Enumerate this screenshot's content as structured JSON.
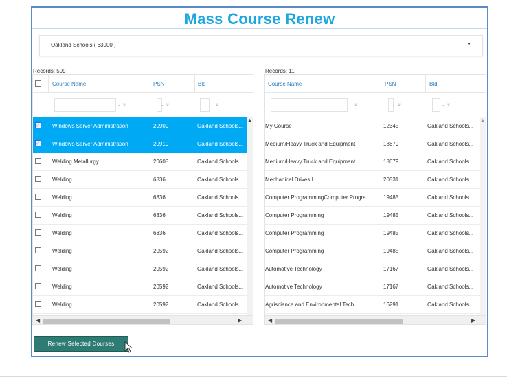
{
  "page": {
    "title": "Mass Course Renew"
  },
  "school_select": {
    "value": "Oakland Schools ( 63000 )"
  },
  "left_grid": {
    "records_label": "Records: 509",
    "columns": [
      "Course Name",
      "PSN",
      "Bld"
    ],
    "rows": [
      {
        "checked": true,
        "course": "Windows Server Administration",
        "psn": "20909",
        "bld": "Oakland Schools...",
        "selected": true
      },
      {
        "checked": true,
        "course": "Windows Server Administration",
        "psn": "20910",
        "bld": "Oakland Schools...",
        "selected": true
      },
      {
        "checked": false,
        "course": "Welding Metallurgy",
        "psn": "20605",
        "bld": "Oakland Schools...",
        "selected": false
      },
      {
        "checked": false,
        "course": "Welding",
        "psn": "6836",
        "bld": "Oakland Schools...",
        "selected": false
      },
      {
        "checked": false,
        "course": "Welding",
        "psn": "6836",
        "bld": "Oakland Schools...",
        "selected": false
      },
      {
        "checked": false,
        "course": "Welding",
        "psn": "6836",
        "bld": "Oakland Schools...",
        "selected": false
      },
      {
        "checked": false,
        "course": "Welding",
        "psn": "6836",
        "bld": "Oakland Schools...",
        "selected": false
      },
      {
        "checked": false,
        "course": "Welding",
        "psn": "20592",
        "bld": "Oakland Schools...",
        "selected": false
      },
      {
        "checked": false,
        "course": "Welding",
        "psn": "20592",
        "bld": "Oakland Schools...",
        "selected": false
      },
      {
        "checked": false,
        "course": "Welding",
        "psn": "20592",
        "bld": "Oakland Schools...",
        "selected": false
      },
      {
        "checked": false,
        "course": "Welding",
        "psn": "20592",
        "bld": "Oakland Schools...",
        "selected": false
      }
    ]
  },
  "right_grid": {
    "records_label": "Records: 11",
    "columns": [
      "Course Name",
      "PSN",
      "Bld"
    ],
    "rows": [
      {
        "course": "My Course",
        "psn": "12345",
        "bld": "Oakland Schools..."
      },
      {
        "course": "Medium/Heavy Truck and Equipment",
        "psn": "18679",
        "bld": "Oakland Schools..."
      },
      {
        "course": "Medium/Heavy Truck and Equipment",
        "psn": "18679",
        "bld": "Oakland Schools..."
      },
      {
        "course": "Mechanical Drives I",
        "psn": "20531",
        "bld": "Oakland Schools..."
      },
      {
        "course": "Computer ProgrammingComputer Progra...",
        "psn": "19485",
        "bld": "Oakland Schools..."
      },
      {
        "course": "Computer Programming",
        "psn": "19485",
        "bld": "Oakland Schools..."
      },
      {
        "course": "Computer Programming",
        "psn": "19485",
        "bld": "Oakland Schools..."
      },
      {
        "course": "Computer Programming",
        "psn": "19485",
        "bld": "Oakland Schools..."
      },
      {
        "course": "Automotive Technology",
        "psn": "17167",
        "bld": "Oakland Schools..."
      },
      {
        "course": "Automotive Technology",
        "psn": "17167",
        "bld": "Oakland Schools..."
      },
      {
        "course": "Agriscience and Environmental Tech",
        "psn": "16291",
        "bld": "Oakland Schools..."
      }
    ]
  },
  "actions": {
    "renew_label": "Renew Selected Courses"
  },
  "icons": {
    "checkbox_checked": "check-icon",
    "filter": "filter-icon",
    "dropdown": "caret-down-icon"
  },
  "colors": {
    "title": "#1fa8e0",
    "selected_row": "#00a9f4",
    "button": "#2e7b74",
    "frame_border": "#5b8bc7",
    "header_text": "#2e7dbd"
  }
}
